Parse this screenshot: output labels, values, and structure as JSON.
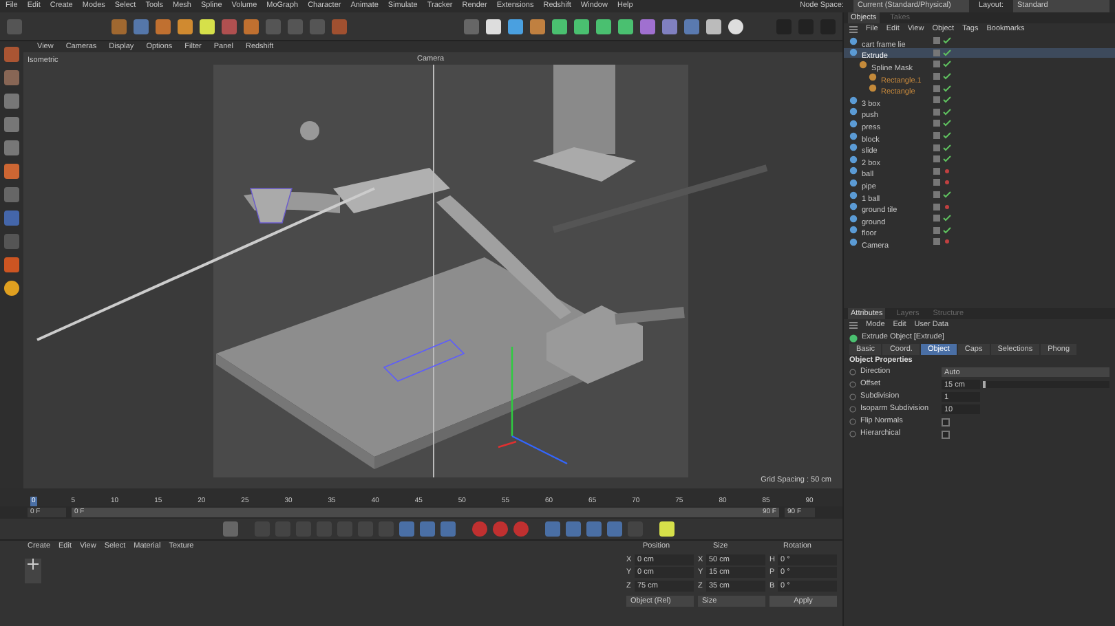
{
  "menu": [
    "File",
    "Edit",
    "Create",
    "Modes",
    "Select",
    "Tools",
    "Mesh",
    "Spline",
    "Volume",
    "MoGraph",
    "Character",
    "Animate",
    "Simulate",
    "Tracker",
    "Render",
    "Extensions",
    "Redshift",
    "Window",
    "Help"
  ],
  "node_space": {
    "label": "Node Space:",
    "value": "Current (Standard/Physical)"
  },
  "layout": {
    "label": "Layout:",
    "value": "Standard"
  },
  "viewport": {
    "menu": [
      "View",
      "Cameras",
      "Display",
      "Options",
      "Filter",
      "Panel",
      "Redshift"
    ],
    "view_name": "Isometric",
    "camera": "Camera",
    "grid_spacing": "Grid Spacing : 50 cm"
  },
  "timeline": {
    "ticks": [
      {
        "label": "0",
        "selected": true
      },
      {
        "label": "5",
        "selected": false
      },
      {
        "label": "10",
        "selected": false
      },
      {
        "label": "15",
        "selected": false
      },
      {
        "label": "20",
        "selected": false
      },
      {
        "label": "25",
        "selected": false
      },
      {
        "label": "30",
        "selected": false
      },
      {
        "label": "35",
        "selected": false
      },
      {
        "label": "40",
        "selected": false
      },
      {
        "label": "45",
        "selected": false
      },
      {
        "label": "50",
        "selected": false
      },
      {
        "label": "55",
        "selected": false
      },
      {
        "label": "60",
        "selected": false
      },
      {
        "label": "65",
        "selected": false
      },
      {
        "label": "70",
        "selected": false
      },
      {
        "label": "75",
        "selected": false
      },
      {
        "label": "80",
        "selected": false
      },
      {
        "label": "85",
        "selected": false
      },
      {
        "label": "90",
        "selected": false
      }
    ],
    "start": "0 F",
    "range_start": "0 F",
    "range_end": "90 F",
    "end": "90 F"
  },
  "material_menu": [
    "Create",
    "Edit",
    "View",
    "Select",
    "Material",
    "Texture"
  ],
  "coordinates": {
    "headers": [
      "Position",
      "Size",
      "Rotation"
    ],
    "rows": [
      [
        {
          "axis": "X",
          "value": "0 cm"
        },
        {
          "axis": "X",
          "value": "50 cm"
        },
        {
          "axis": "H",
          "value": "0 °"
        }
      ],
      [
        {
          "axis": "Y",
          "value": "0 cm"
        },
        {
          "axis": "Y",
          "value": "15 cm"
        },
        {
          "axis": "P",
          "value": "0 °"
        }
      ],
      [
        {
          "axis": "Z",
          "value": "75 cm"
        },
        {
          "axis": "Z",
          "value": "35 cm"
        },
        {
          "axis": "B",
          "value": "0 °"
        }
      ]
    ],
    "mode": "Object (Rel)",
    "size_mode": "Size",
    "apply": "Apply"
  },
  "objects_tabs": [
    {
      "label": "Objects",
      "selected": true
    },
    {
      "label": "Takes",
      "selected": false
    }
  ],
  "objects_menu": [
    "File",
    "Edit",
    "View",
    "Object",
    "Tags",
    "Bookmarks"
  ],
  "objects": [
    {
      "name": "cart frame lie",
      "selected": false,
      "enabled": true
    },
    {
      "name": "Extrude",
      "selected": true,
      "enabled": true,
      "children": [
        {
          "name": "Spline Mask",
          "selected": false,
          "enabled": true,
          "children": [
            {
              "name": "Rectangle.1",
              "selected": false,
              "enabled": true
            },
            {
              "name": "Rectangle",
              "selected": false,
              "enabled": true
            }
          ]
        }
      ]
    },
    {
      "name": "3 box",
      "selected": false,
      "enabled": true
    },
    {
      "name": "push",
      "selected": false,
      "enabled": true
    },
    {
      "name": "press",
      "selected": false,
      "enabled": true
    },
    {
      "name": "block",
      "selected": false,
      "enabled": true
    },
    {
      "name": "slide",
      "selected": false,
      "enabled": true
    },
    {
      "name": "2 box",
      "selected": false,
      "enabled": true
    },
    {
      "name": "ball",
      "selected": false,
      "enabled": false
    },
    {
      "name": "pipe",
      "selected": false,
      "enabled": false
    },
    {
      "name": "1 ball",
      "selected": false,
      "enabled": true
    },
    {
      "name": "ground tile",
      "selected": false,
      "enabled": false
    },
    {
      "name": "ground",
      "selected": false,
      "enabled": true
    },
    {
      "name": "floor",
      "selected": false,
      "enabled": true
    },
    {
      "name": "Camera",
      "selected": false,
      "enabled": false
    }
  ],
  "attributes_tabs": [
    {
      "label": "Attributes",
      "selected": true
    },
    {
      "label": "Layers",
      "selected": false
    },
    {
      "label": "Structure",
      "selected": false
    }
  ],
  "attributes_menu": [
    "Mode",
    "Edit",
    "User Data"
  ],
  "attributes_title": "Extrude Object [Extrude]",
  "attribute_tabs": [
    {
      "label": "Basic",
      "selected": false
    },
    {
      "label": "Coord.",
      "selected": false
    },
    {
      "label": "Object",
      "selected": true
    },
    {
      "label": "Caps",
      "selected": false
    },
    {
      "label": "Selections",
      "selected": false
    },
    {
      "label": "Phong",
      "selected": false
    }
  ],
  "section": "Object Properties",
  "properties": [
    {
      "kind": "dropdown",
      "label": "Direction",
      "value": "Auto"
    },
    {
      "kind": "slider",
      "label": "Offset",
      "value": "15 cm",
      "level": 0.02
    },
    {
      "kind": "number",
      "label": "Subdivision",
      "value": "1"
    },
    {
      "kind": "number",
      "label": "Isoparm Subdivision",
      "value": "10"
    },
    {
      "kind": "checkbox",
      "label": "Flip Normals",
      "checked": false
    },
    {
      "kind": "checkbox",
      "label": "Hierarchical",
      "checked": false
    }
  ]
}
